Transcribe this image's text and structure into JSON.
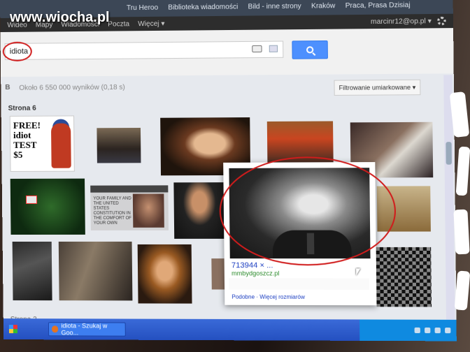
{
  "watermark": "www.wiocha.pl",
  "bookmarks": [
    "Tru Heroo",
    "Biblioteka wiadomości",
    "Bild - inne strony",
    "Kraków",
    "Praca, Prasa Dzisiaj"
  ],
  "gbar": {
    "links": [
      "Wideo",
      "Mapy",
      "Wiadomości",
      "Poczta",
      "Więcej ▾"
    ],
    "account": "marcinr12@op.pl ▾"
  },
  "search": {
    "query": "idiota"
  },
  "results": {
    "prefix": "B",
    "count_text": "Około 6 550 000 wyników (0,18 s)",
    "filter_label": "Filtrowanie umiarkowane ▾",
    "page_label": "Strona 6",
    "page_label_next": "Strona 2"
  },
  "thumb_idiot": {
    "lines": [
      "FREE!",
      "idiot",
      "TEST",
      "$5"
    ]
  },
  "poster_text": "YOUR FAMILY AND THE UNITED STATES CONSTITUTION IN THE COMFORT OF YOUR OWN",
  "preview": {
    "resolution": "713944 × ...",
    "source": "mmbydgoszcz.pl",
    "links": "Podobne · Więcej rozmiarów"
  },
  "taskbar": {
    "task_label": "idiota - Szukaj w Goo..."
  },
  "colors": {
    "annotation_red": "#d01c1c",
    "search_button": "#4d90fe",
    "link_blue": "#1a3dc1",
    "url_green": "#2a8a2a"
  }
}
